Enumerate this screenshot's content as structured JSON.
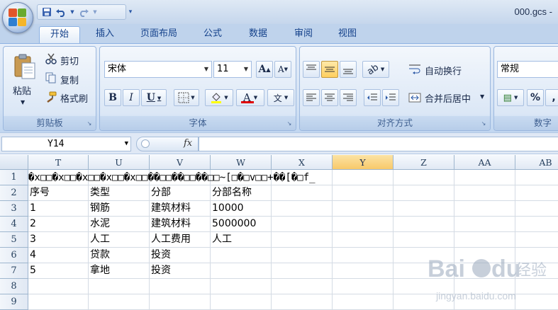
{
  "window": {
    "title": "000.gcs -"
  },
  "qat": {
    "save_icon": "save-icon",
    "undo_icon": "undo-icon",
    "redo_icon": "redo-icon"
  },
  "tabs": [
    "开始",
    "插入",
    "页面布局",
    "公式",
    "数据",
    "审阅",
    "视图"
  ],
  "ribbon": {
    "clipboard": {
      "label": "剪贴板",
      "paste": "粘贴",
      "cut": "剪切",
      "copy": "复制",
      "format_painter": "格式刷"
    },
    "font": {
      "label": "字体",
      "font_name": "宋体",
      "font_size": "11",
      "bold": "B",
      "italic": "I",
      "underline": "U",
      "grow": "A",
      "shrink": "A",
      "font_color_letter": "A",
      "phonetic": "文"
    },
    "alignment": {
      "label": "对齐方式",
      "wrap_text": "自动换行",
      "merge_center": "合并后居中"
    },
    "number": {
      "label": "数字",
      "format": "常规",
      "percent": "%",
      "comma": ","
    }
  },
  "formula_bar": {
    "name_box": "Y14",
    "fx": "fx",
    "formula": ""
  },
  "grid": {
    "columns": [
      "T",
      "U",
      "V",
      "W",
      "X",
      "Y",
      "Z",
      "AA",
      "AB"
    ],
    "selected_column": "Y",
    "rows": [
      "1",
      "2",
      "3",
      "4",
      "5",
      "6",
      "7",
      "8",
      "9"
    ],
    "row1_garbled": "�x□□�x□□�x□□�x□□�x□□��□□��□□��□□~[□�□v□□+��[�□f_",
    "cells": [
      [
        "序号",
        "类型",
        "分部",
        "分部名称"
      ],
      [
        "1",
        "钢筋",
        "建筑材料",
        "10000"
      ],
      [
        "2",
        "水泥",
        "建筑材料",
        "5000000"
      ],
      [
        "3",
        "人工",
        "人工费用",
        "人工"
      ],
      [
        "4",
        "贷款",
        "投资",
        ""
      ],
      [
        "5",
        "拿地",
        "投资",
        ""
      ]
    ]
  },
  "watermark": {
    "brand": "Bai",
    "brand2": "du",
    "cn": "经验",
    "url": "jingyan.baidu.com"
  },
  "colors": {
    "accent": "#15428b",
    "selected_col": "#f8c96a",
    "ribbon": "#d2e1f4"
  }
}
